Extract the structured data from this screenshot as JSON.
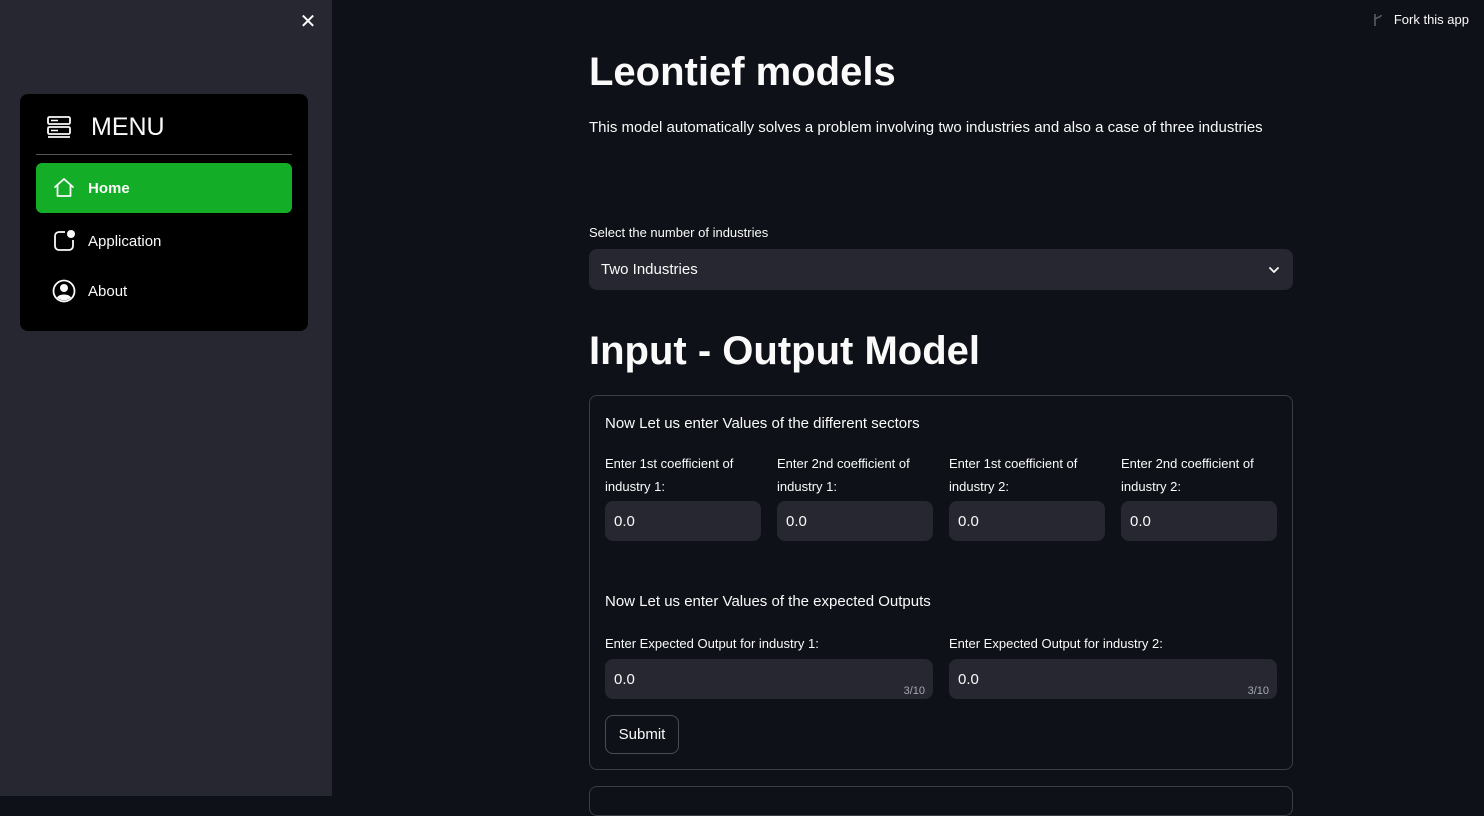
{
  "sidebar": {
    "close_label": "✕",
    "menu": {
      "title": "MENU",
      "icon": "server-icon",
      "items": [
        {
          "label": "Home",
          "icon": "house-icon",
          "active": true
        },
        {
          "label": "Application",
          "icon": "app-indicator-icon",
          "active": false
        },
        {
          "label": "About",
          "icon": "person-circle-icon",
          "active": false
        }
      ],
      "active_color": "#14ad28"
    }
  },
  "header": {
    "fork_label": "Fork this app"
  },
  "main": {
    "title": "Leontief models",
    "subtitle": "This model automatically solves a problem involving two industries and also a case of three industries",
    "select": {
      "label": "Select the number of industries",
      "value": "Two Industries"
    },
    "section_title": "Input - Output Model",
    "form": {
      "sectors_heading": "Now Let us enter Values of the different sectors",
      "coefficients": [
        {
          "label": "Enter 1st coefficient of industry 1:",
          "value": "0.0"
        },
        {
          "label": "Enter 2nd coefficient of industry 1:",
          "value": "0.0"
        },
        {
          "label": "Enter 1st coefficient of industry 2:",
          "value": "0.0"
        },
        {
          "label": "Enter 2nd coefficient of industry 2:",
          "value": "0.0"
        }
      ],
      "outputs_heading": "Now Let us enter Values of the expected Outputs",
      "outputs": [
        {
          "label": "Enter Expected Output for industry 1:",
          "value": "0.0",
          "counter": "3/10"
        },
        {
          "label": "Enter Expected Output for industry 2:",
          "value": "0.0",
          "counter": "3/10"
        }
      ],
      "submit_label": "Submit"
    }
  },
  "colors": {
    "background": "#0e1117",
    "sidebar": "#262730",
    "input": "#262730",
    "accent": "#14ad28"
  }
}
